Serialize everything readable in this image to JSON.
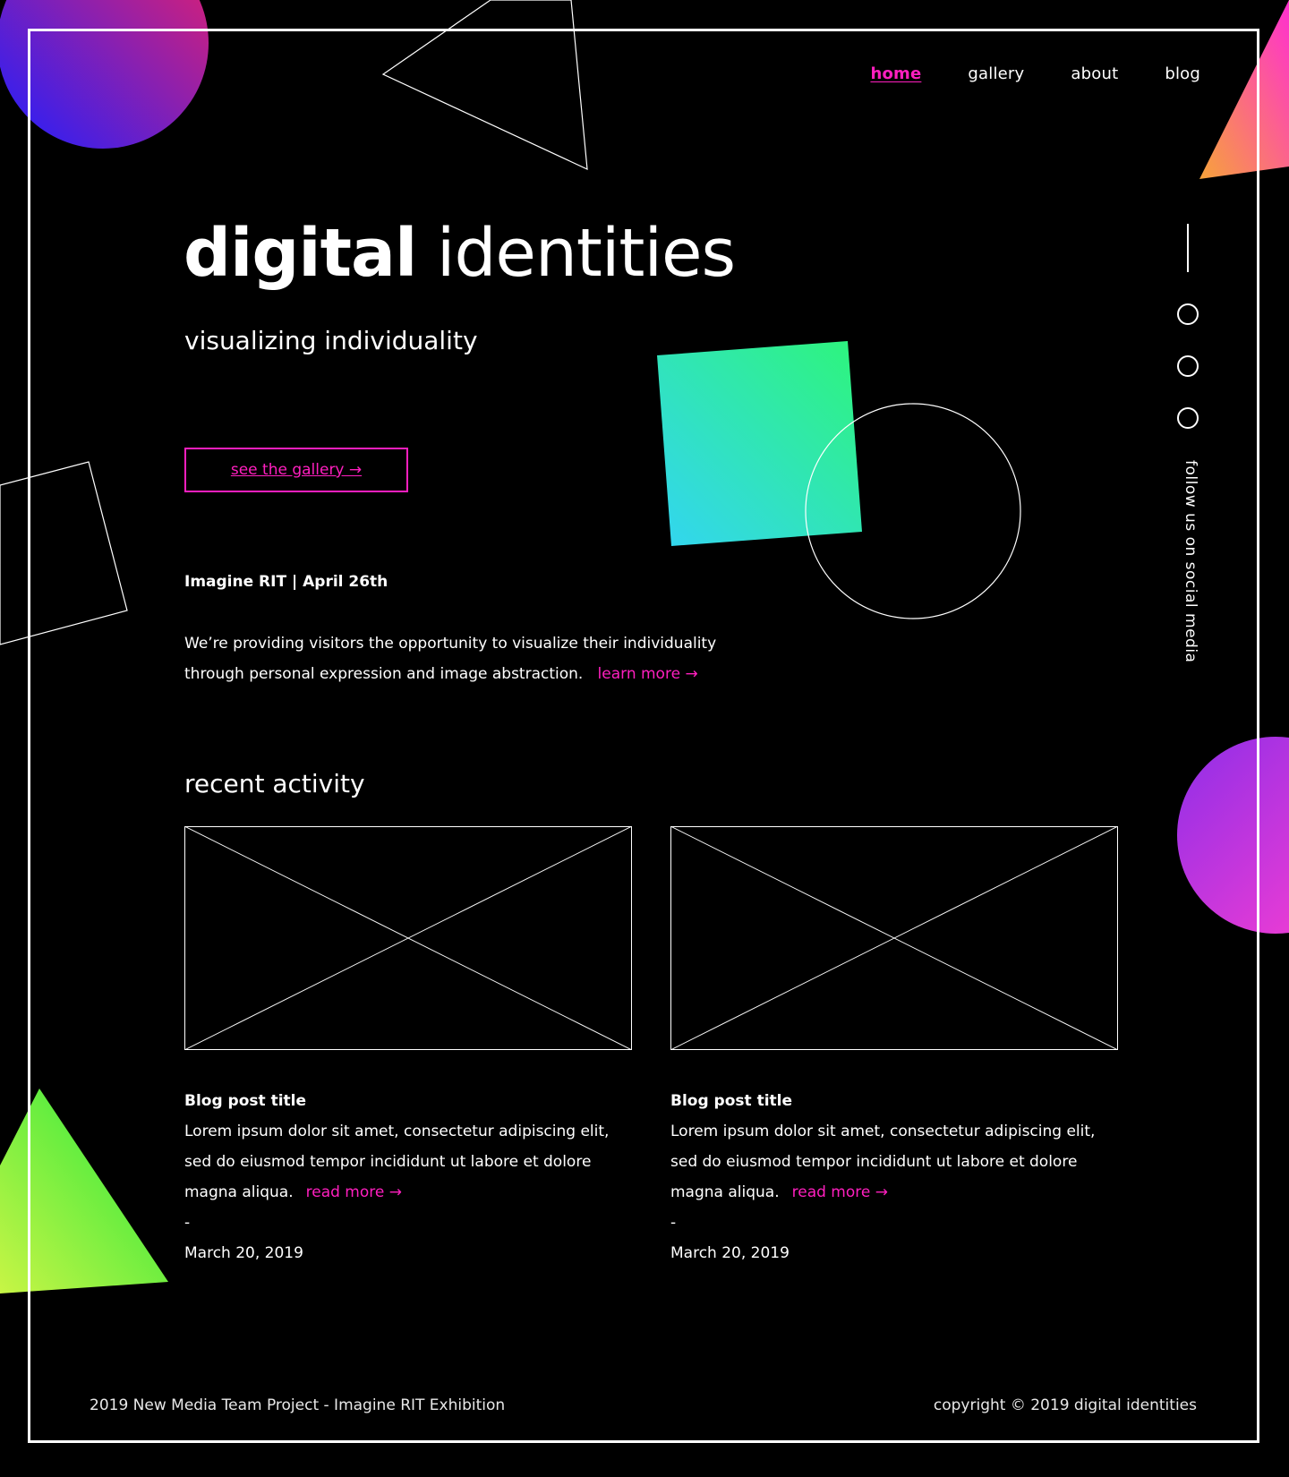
{
  "nav": {
    "items": [
      {
        "label": "home",
        "active": true
      },
      {
        "label": "gallery",
        "active": false
      },
      {
        "label": "about",
        "active": false
      },
      {
        "label": "blog",
        "active": false
      }
    ]
  },
  "hero": {
    "title_bold": "digital",
    "title_light": "identities",
    "subtitle": "visualizing individuality",
    "cta_label": "see the gallery →",
    "event": "Imagine RIT | April 26th",
    "description": "We’re providing visitors the opportunity to visualize their individuality through personal expression and image abstraction.",
    "learn_more": "learn more →"
  },
  "recent": {
    "title": "recent activity",
    "posts": [
      {
        "title": "Blog post title",
        "body": "Lorem ipsum dolor sit amet, consectetur adipiscing elit, sed do eiusmod tempor incididunt ut labore et dolore magna aliqua.",
        "read_more": "read more →",
        "separator": "-",
        "date": "March 20, 2019"
      },
      {
        "title": "Blog post title",
        "body": "Lorem ipsum dolor sit amet, consectetur adipiscing elit, sed do eiusmod tempor incididunt ut labore et dolore magna aliqua.",
        "read_more": "read more →",
        "separator": "-",
        "date": "March 20, 2019"
      }
    ]
  },
  "social": {
    "label": "follow us on social media",
    "icon_count": 3
  },
  "footer": {
    "left": "2019 New Media Team Project - Imagine RIT Exhibition",
    "right": "copyright © 2019 digital identities"
  },
  "colors": {
    "background": "#000000",
    "accent": "#ff1fbf",
    "text": "#ffffff"
  }
}
